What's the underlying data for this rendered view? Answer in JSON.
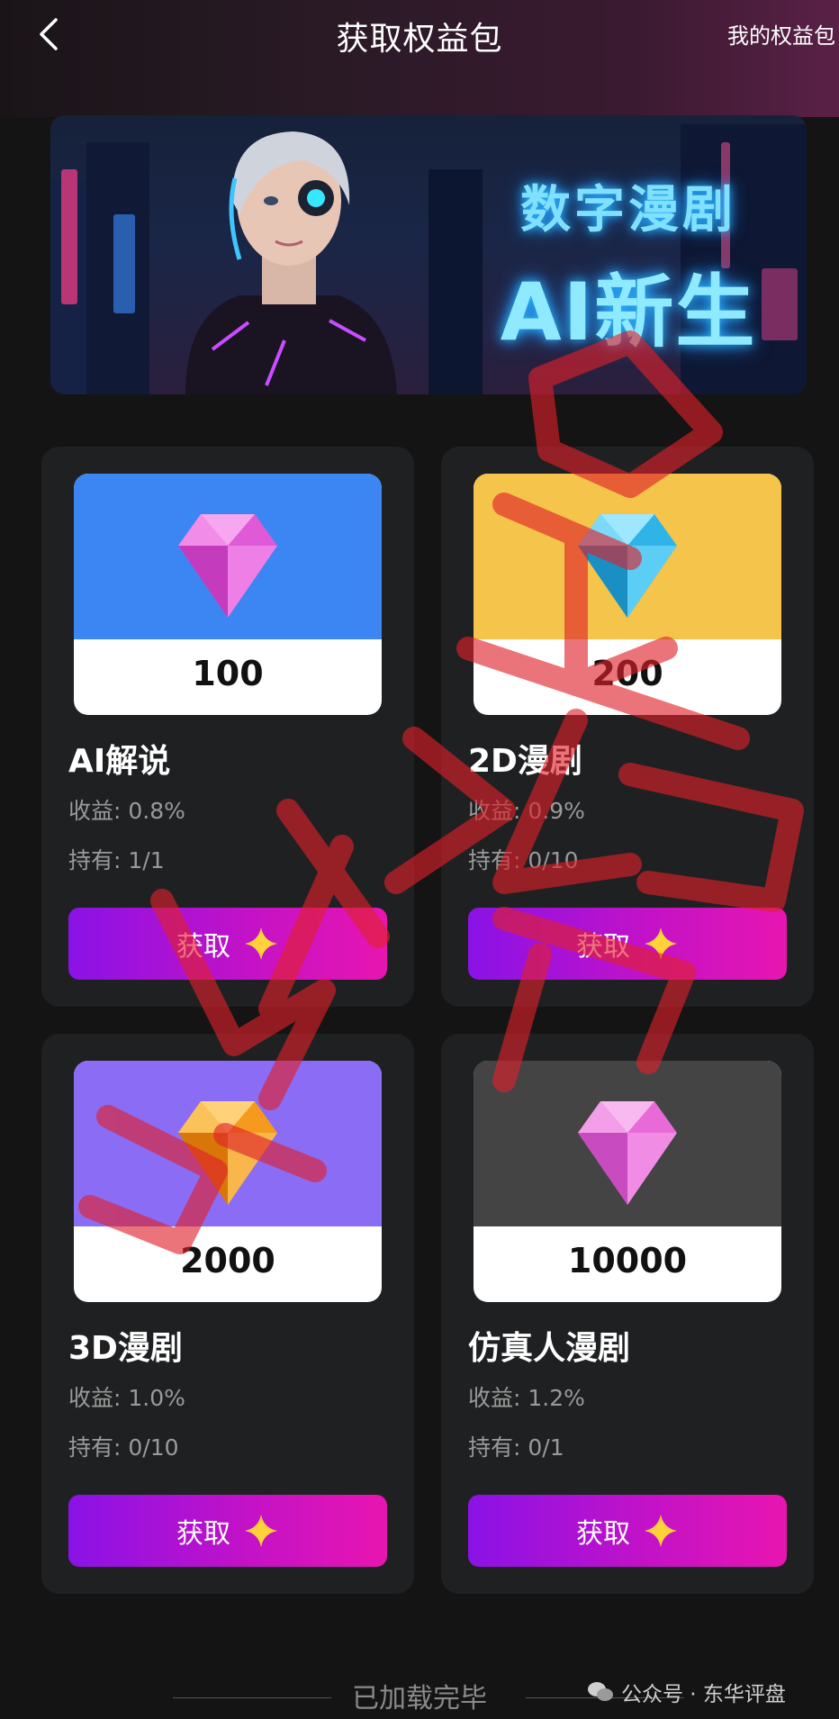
{
  "header": {
    "title": "获取权益包",
    "right_link": "我的权益包",
    "back_icon": "chevron-left-icon"
  },
  "banner": {
    "line1": "数字漫剧",
    "line2": "AI新生"
  },
  "cards": [
    {
      "amount": "100",
      "name": "AI解说",
      "income": "收益: 0.8%",
      "hold": "持有: 1/1",
      "button": "获取",
      "top_color": "#3b86f2",
      "gem_color": "#e05ad8",
      "icon": "diamond-pink-icon"
    },
    {
      "amount": "200",
      "name": "2D漫剧",
      "income": "收益: 0.9%",
      "hold": "持有: 0/10",
      "button": "获取",
      "top_color": "#f5c44a",
      "gem_color": "#2fb4e8",
      "icon": "diamond-blue-icon"
    },
    {
      "amount": "2000",
      "name": "3D漫剧",
      "income": "收益: 1.0%",
      "hold": "持有: 0/10",
      "button": "获取",
      "top_color": "#8b6cf5",
      "gem_color": "#f59a1c",
      "icon": "diamond-orange-icon"
    },
    {
      "amount": "10000",
      "name": "仿真人漫剧",
      "income": "收益: 1.2%",
      "hold": "持有: 0/1",
      "button": "获取",
      "top_color": "#444444",
      "gem_color": "#e86ad8",
      "icon": "diamond-magenta-icon"
    }
  ],
  "footer": {
    "status": "已加载完毕"
  },
  "watermark": {
    "text": "公众号 · 东华评盘",
    "icon": "wechat-icon"
  },
  "stamp": {
    "icon": "red-scribble-stamp",
    "color": "#e0202a"
  }
}
